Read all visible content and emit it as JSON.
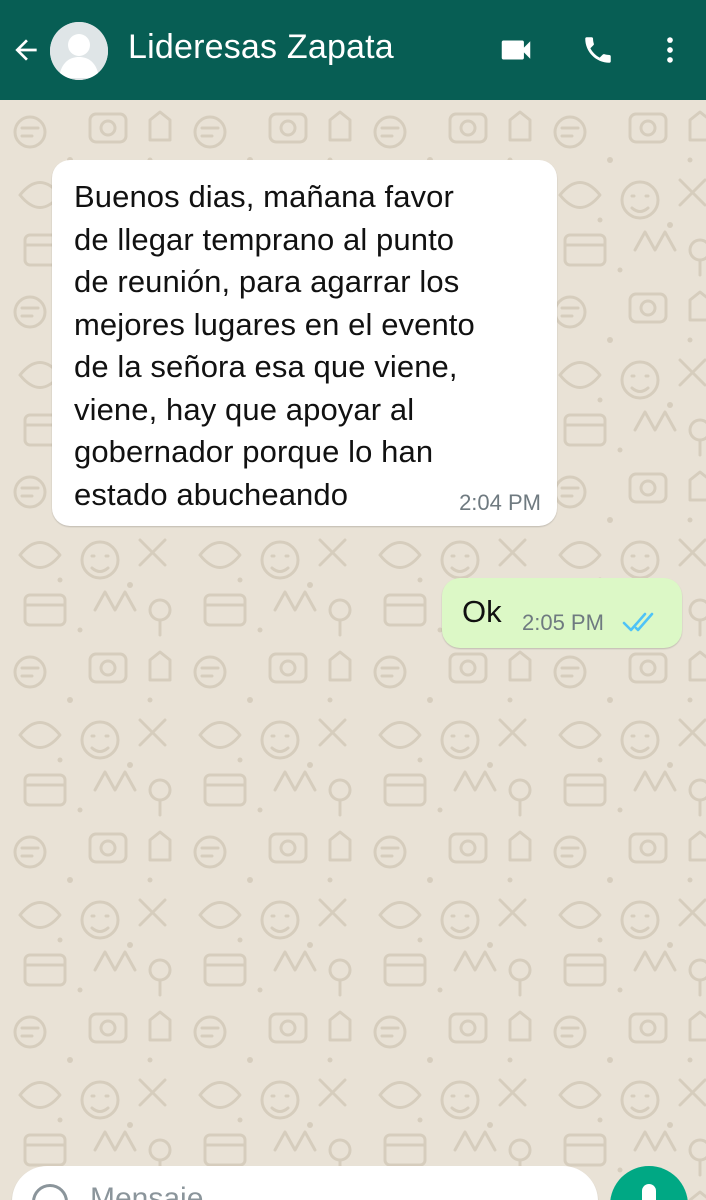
{
  "header": {
    "contact_name": "Lideresas Zapata",
    "background": "#075e54",
    "icons": [
      "back-arrow-icon",
      "avatar-placeholder-icon",
      "video-camera-icon",
      "phone-icon",
      "more-vertical-icon"
    ]
  },
  "messages": [
    {
      "direction": "incoming",
      "text": "Buenos dias, mañana favor\nde llegar temprano al punto\nde reunión, para agarrar los\nmejores lugares en el evento\nde la señora esa que viene,\nviene, hay que apoyar al\ngobernador porque lo han\nestado abucheando",
      "time": "2:04 PM"
    },
    {
      "direction": "outgoing",
      "text": "Ok",
      "time": "2:05 PM",
      "status": "read",
      "status_icon": "double-check-icon",
      "status_color": "#4fc3f7"
    }
  ],
  "composer": {
    "placeholder": "Mensaje",
    "icons": [
      "emoji-icon",
      "microphone-icon"
    ],
    "accent": "#00a884"
  },
  "colors": {
    "chat_background": "#e9e2d6",
    "incoming_bubble": "#ffffff",
    "outgoing_bubble": "#dcf8c6"
  }
}
